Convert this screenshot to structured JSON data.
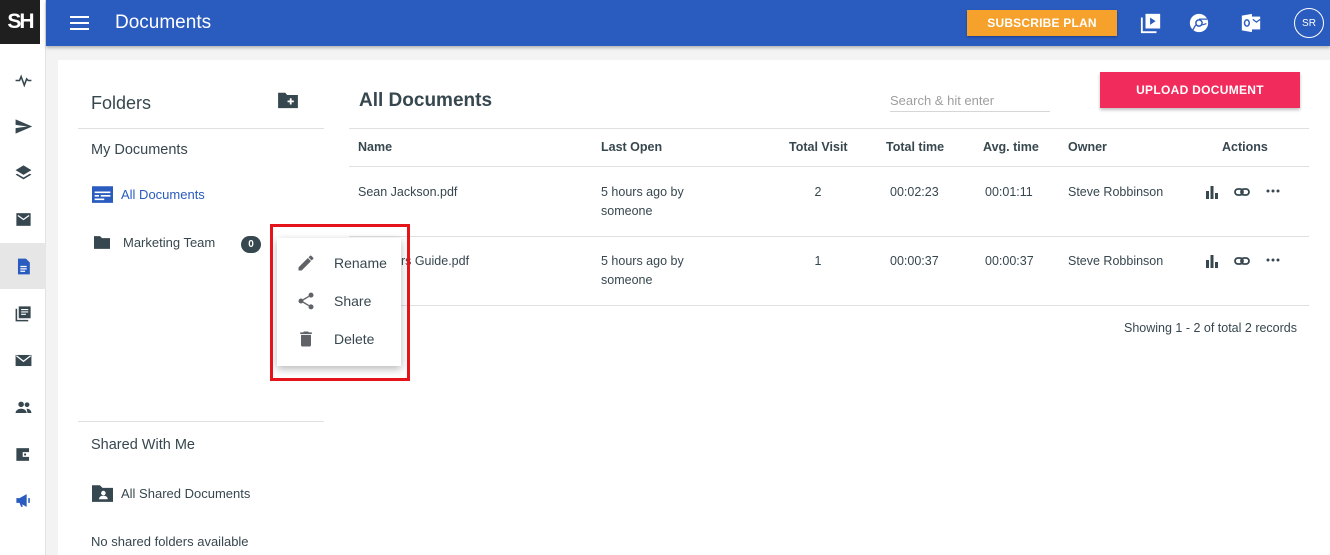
{
  "app": {
    "logo": "SH",
    "title": "Documents",
    "subscribe_label": "SUBSCRIBE PLAN",
    "avatar_initials": "SR",
    "brand_color": "#2a5bbf"
  },
  "rail": {
    "items": [
      {
        "icon": "activity-icon"
      },
      {
        "icon": "send-icon"
      },
      {
        "icon": "layers-icon"
      },
      {
        "icon": "inbox-icon"
      },
      {
        "icon": "document-icon",
        "active": true
      },
      {
        "icon": "library-icon"
      },
      {
        "icon": "mail-icon"
      },
      {
        "icon": "people-icon"
      },
      {
        "icon": "wallet-icon"
      },
      {
        "icon": "megaphone-icon"
      }
    ]
  },
  "folders": {
    "title": "Folders",
    "my_documents": "My Documents",
    "all_documents": "All Documents",
    "marketing_team": "Marketing Team",
    "marketing_count": "0",
    "shared_with_me": "Shared With Me",
    "all_shared_documents": "All Shared Documents",
    "no_shared": "No shared folders available"
  },
  "documents": {
    "title": "All Documents",
    "search_placeholder": "Search & hit enter",
    "upload_label": "UPLOAD DOCUMENT",
    "columns": [
      "Name",
      "Last Open",
      "Total Visit",
      "Total time",
      "Avg. time",
      "Owner",
      "Actions"
    ],
    "rows": [
      {
        "name": "Sean Jackson.pdf",
        "last_open_1": "5 hours ago by",
        "last_open_2": "someone",
        "visits": "2",
        "total_time": "00:02:23",
        "avg_time": "00:01:11",
        "owner": "Steve Robbinson"
      },
      {
        "name": "Sellers Guide.pdf",
        "name_visible": "ers Guide.pdf",
        "last_open_1": "5 hours ago by",
        "last_open_2": "someone",
        "visits": "1",
        "total_time": "00:00:37",
        "avg_time": "00:00:37",
        "owner": "Steve Robbinson"
      }
    ],
    "records": "Showing 1 - 2 of total 2 records"
  },
  "context_menu": {
    "items": [
      "Rename",
      "Share",
      "Delete"
    ]
  }
}
